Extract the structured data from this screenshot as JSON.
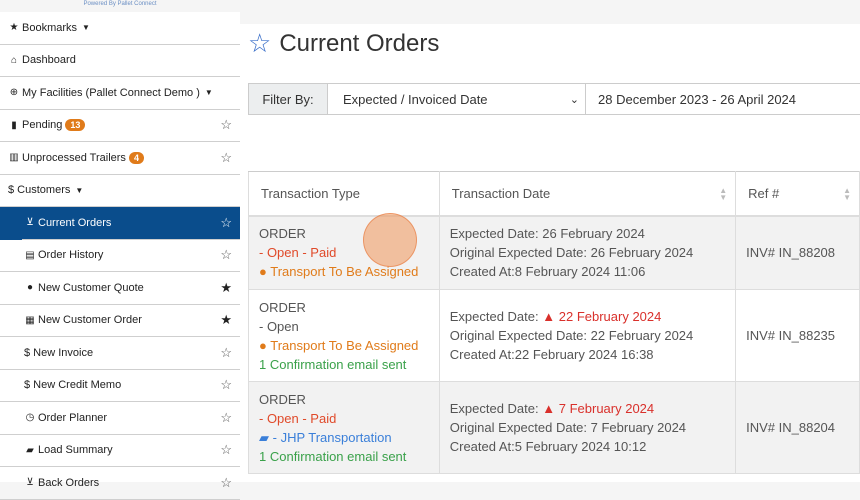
{
  "powered_by": "Powered By Pallet Connect",
  "sidebar": {
    "items": [
      {
        "icon": "star-icon",
        "label": "Bookmarks",
        "caret": true
      },
      {
        "icon": "home-icon",
        "label": "Dashboard"
      },
      {
        "icon": "globe-icon",
        "label": "My Facilities (Pallet Connect Demo )",
        "caret": true
      },
      {
        "icon": "document-icon",
        "label": "Pending",
        "badge": "13"
      },
      {
        "icon": "truck-icon",
        "label": "Unprocessed Trailers",
        "badge": "4"
      },
      {
        "icon": "dollar-icon",
        "label": "$ Customers",
        "caret": true
      },
      {
        "icon": "cart-icon",
        "label": "Current Orders",
        "active": true
      },
      {
        "icon": "file-icon",
        "label": "Order History"
      },
      {
        "icon": "comment-icon",
        "label": "New Customer Quote",
        "starred": true
      },
      {
        "icon": "form-icon",
        "label": "New Customer Order",
        "starred": true
      },
      {
        "icon": "dollar-icon",
        "label": "$ New Invoice"
      },
      {
        "icon": "dollar-icon",
        "label": "$ New Credit Memo"
      },
      {
        "icon": "clock-icon",
        "label": "Order Planner"
      },
      {
        "icon": "truck-icon",
        "label": "Load Summary"
      },
      {
        "icon": "cart-icon",
        "label": "Back Orders"
      }
    ]
  },
  "main": {
    "title": "Current Orders",
    "filter": {
      "label": "Filter By:",
      "selected": "Expected / Invoiced Date",
      "date_range": "28 December 2023 - 26 April 2024"
    },
    "table": {
      "headers": [
        "Transaction Type",
        "Transaction Date",
        "Ref #"
      ],
      "rows": [
        {
          "type": "ORDER",
          "status": "- Open - Paid",
          "transport": "Transport To Be Assigned",
          "expected_label": "Expected Date:",
          "expected": "26 February 2024",
          "original": "Original Expected Date: 26 February 2024",
          "created": "Created At:8 February 2024 11:06",
          "ref": "INV# IN_88208"
        },
        {
          "type": "ORDER",
          "status": "- Open",
          "transport": "Transport To Be Assigned",
          "email": "1 Confirmation email sent",
          "expected_label": "Expected Date:",
          "expected": "22 February 2024",
          "original": "Original Expected Date: 22 February 2024",
          "created": "Created At:22 February 2024 16:38",
          "ref": "INV# IN_88235"
        },
        {
          "type": "ORDER",
          "status": "- Open - Paid",
          "transport": "- JHP Transportation",
          "email": "1 Confirmation email sent",
          "expected_label": "Expected Date:",
          "expected": "7 February 2024",
          "original": "Original Expected Date: 7 February 2024",
          "created": "Created At:5 February 2024 10:12",
          "ref": "INV# IN_88204"
        }
      ]
    }
  }
}
